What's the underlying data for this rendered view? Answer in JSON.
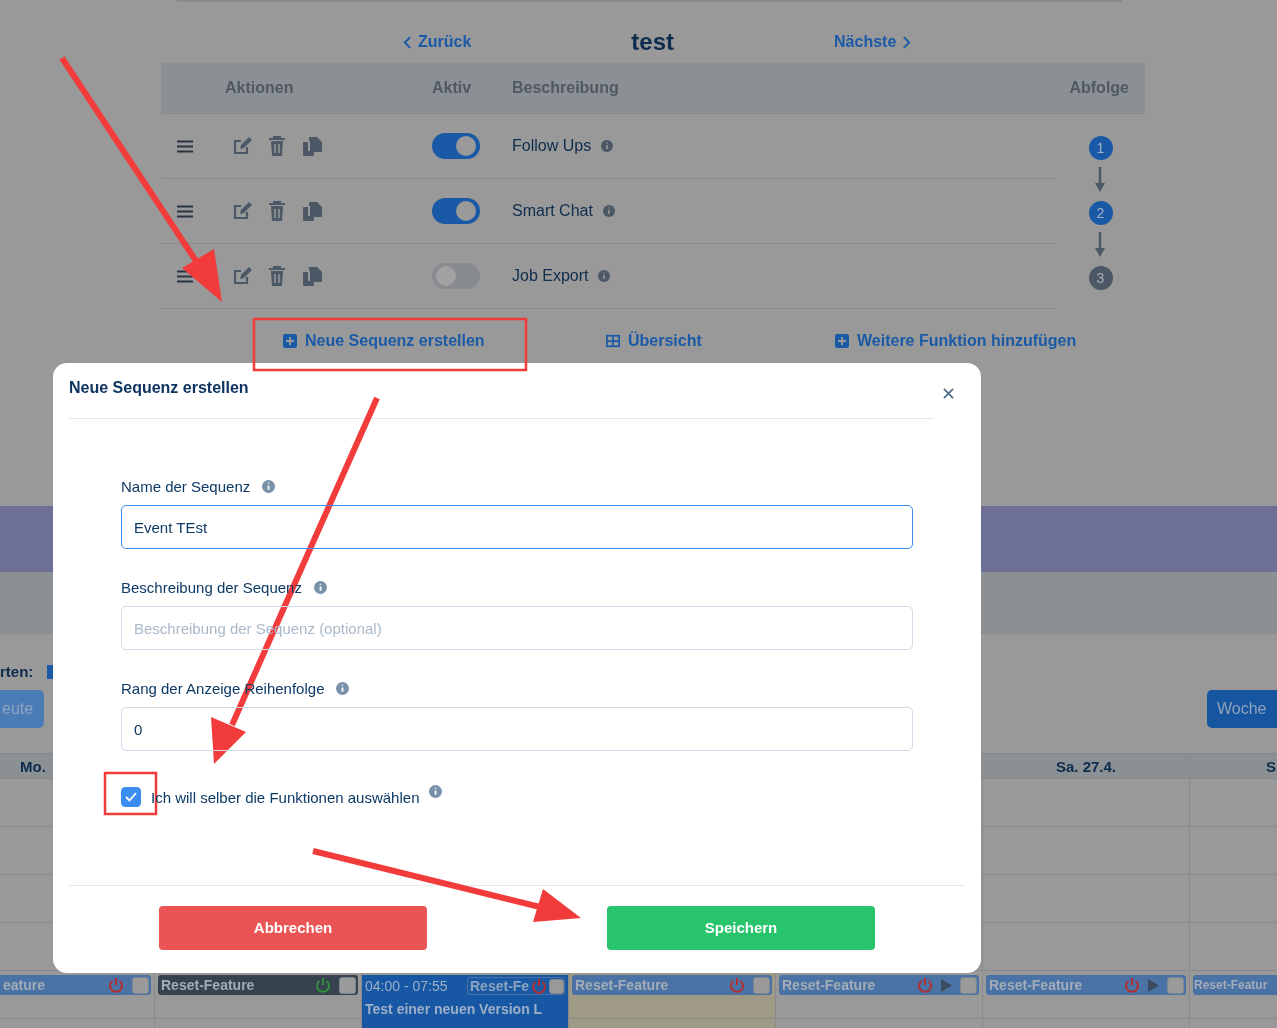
{
  "nav": {
    "back": "Zurück",
    "title": "test",
    "next": "Nächste"
  },
  "table": {
    "columns": [
      "Aktionen",
      "Aktiv",
      "Beschreibung",
      "Abfolge"
    ],
    "rows": [
      {
        "name": "Follow Ups",
        "active": true,
        "step": "1"
      },
      {
        "name": "Smart Chat",
        "active": true,
        "step": "2"
      },
      {
        "name": "Job Export",
        "active": false,
        "step": "3"
      }
    ]
  },
  "actions": [
    {
      "label": "Neue Sequenz erstellen",
      "kind": "plus"
    },
    {
      "label": "Übersicht",
      "kind": "grid"
    },
    {
      "label": "Weitere Funktion hinzufügen",
      "kind": "plus"
    }
  ],
  "calendar": {
    "legend_label": "rten:",
    "today_button": "eute",
    "view_button": "Woche",
    "columns": [
      {
        "day": "Mo.",
        "highlighted": false,
        "event": {
          "kind": "bar",
          "label": "eature",
          "power_on": false,
          "play": false,
          "dark": false,
          "checked": false
        }
      },
      {
        "highlighted": false,
        "event": {
          "kind": "bar",
          "label": "Reset-Feature",
          "power_on": true,
          "play": false,
          "dark": true,
          "checked": false
        }
      },
      {
        "highlighted": false,
        "event": {
          "kind": "timed",
          "time": "04:00 - 07:55",
          "chip": "Reset-Fe",
          "power_on": false,
          "checked": false,
          "title": "Test einer neuen Version L"
        }
      },
      {
        "highlighted": true,
        "event": {
          "kind": "bar",
          "label": "Reset-Feature",
          "power_on": false,
          "play": false,
          "dark": false,
          "checked": false
        }
      },
      {
        "highlighted": false,
        "event": {
          "kind": "bar",
          "label": "Reset-Feature",
          "power_on": false,
          "play": true,
          "dark": false,
          "checked": false
        }
      },
      {
        "day": "Sa. 27.4.",
        "highlighted": false,
        "event": {
          "kind": "bar",
          "label": "Reset-Feature",
          "power_on": false,
          "play": true,
          "dark": false,
          "checked": false
        }
      },
      {
        "day": "S",
        "highlighted": false,
        "event": {
          "kind": "cut",
          "label": "Reset-Featur"
        }
      }
    ]
  },
  "modal": {
    "title": "Neue Sequenz erstellen",
    "fields": [
      {
        "label": "Name der Sequenz",
        "value": "Event TEst",
        "focused": true
      },
      {
        "label": "Beschreibung der Sequenz",
        "placeholder": "Beschreibung der Sequenz (optional)",
        "focused": false
      },
      {
        "label": "Rang der Anzeige Reihenfolge",
        "value": "0",
        "focused": false
      }
    ],
    "checkbox": {
      "label": "Ich will selber die Funktionen auswählen",
      "checked": true
    },
    "buttons": [
      {
        "label": "Abbrechen",
        "kind": "cancel"
      },
      {
        "label": "Speichern",
        "kind": "save"
      }
    ]
  }
}
